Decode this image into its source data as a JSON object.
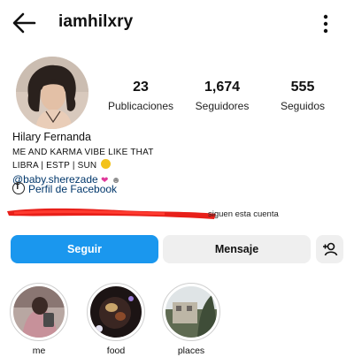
{
  "header": {
    "username": "iamhilxry"
  },
  "stats": [
    {
      "value": "23",
      "label": "Publicaciones"
    },
    {
      "value": "1,674",
      "label": "Seguidores"
    },
    {
      "value": "555",
      "label": "Seguidos"
    }
  ],
  "bio": {
    "name": "Hilary Fernanda",
    "line1": "ME AND KARMA VIBE LIKE THAT",
    "line2": "LIBRA | ESTP | SUN",
    "mention": "@baby.sherezade",
    "facebook_link": "Perfil de Facebook"
  },
  "mutual_text": "siguen esta cuenta",
  "buttons": {
    "follow": "Seguir",
    "message": "Mensaje"
  },
  "highlights": [
    {
      "label": "me"
    },
    {
      "label": "food"
    },
    {
      "label": "places"
    }
  ],
  "colors": {
    "accent": "#1a97ee",
    "link": "#00376b",
    "redaction": "#e8201a"
  },
  "icons": [
    "back-arrow-icon",
    "more-options-icon",
    "facebook-icon",
    "add-person-icon"
  ]
}
